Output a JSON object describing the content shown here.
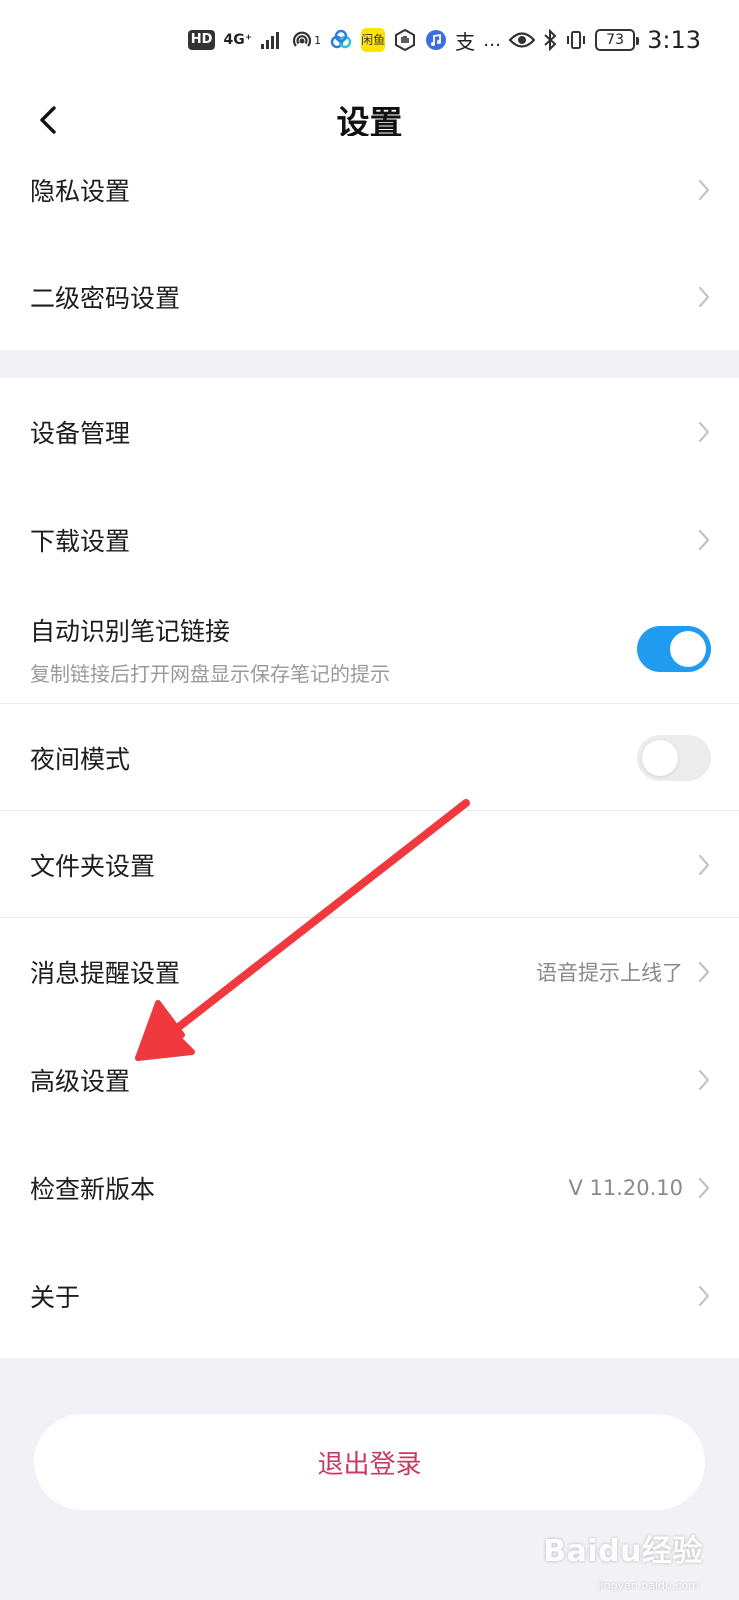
{
  "status_bar": {
    "time": "3:13",
    "battery": "73",
    "hd": "HD",
    "network": "4G⁺",
    "hotspot_count": "1",
    "app_icon_label": "闲鱼",
    "alipay_glyph": "支",
    "more": "…"
  },
  "header": {
    "title": "设置"
  },
  "group1": [
    {
      "label": "隐私设置"
    },
    {
      "label": "二级密码设置"
    }
  ],
  "group2": {
    "device": {
      "label": "设备管理"
    },
    "download": {
      "label": "下载设置"
    },
    "auto_link": {
      "label": "自动识别笔记链接",
      "sub": "复制链接后打开网盘显示保存笔记的提示",
      "enabled": true
    },
    "night_mode": {
      "label": "夜间模式",
      "enabled": false
    },
    "folder": {
      "label": "文件夹设置"
    },
    "message": {
      "label": "消息提醒设置",
      "value": "语音提示上线了"
    },
    "advanced": {
      "label": "高级设置"
    },
    "version": {
      "label": "检查新版本",
      "value": "V 11.20.10"
    },
    "about": {
      "label": "关于"
    }
  },
  "logout": {
    "label": "退出登录"
  },
  "watermark": {
    "text": "Baidu经验",
    "sub": "jingyan.baidu.com"
  },
  "colors": {
    "accent": "#1f9bf0",
    "logout": "#c83a63",
    "annotation_arrow": "#f0383f",
    "band": "#f2f2f6"
  },
  "icons": {
    "back": "chevron-left-icon",
    "row_arrow": "chevron-right-icon"
  }
}
